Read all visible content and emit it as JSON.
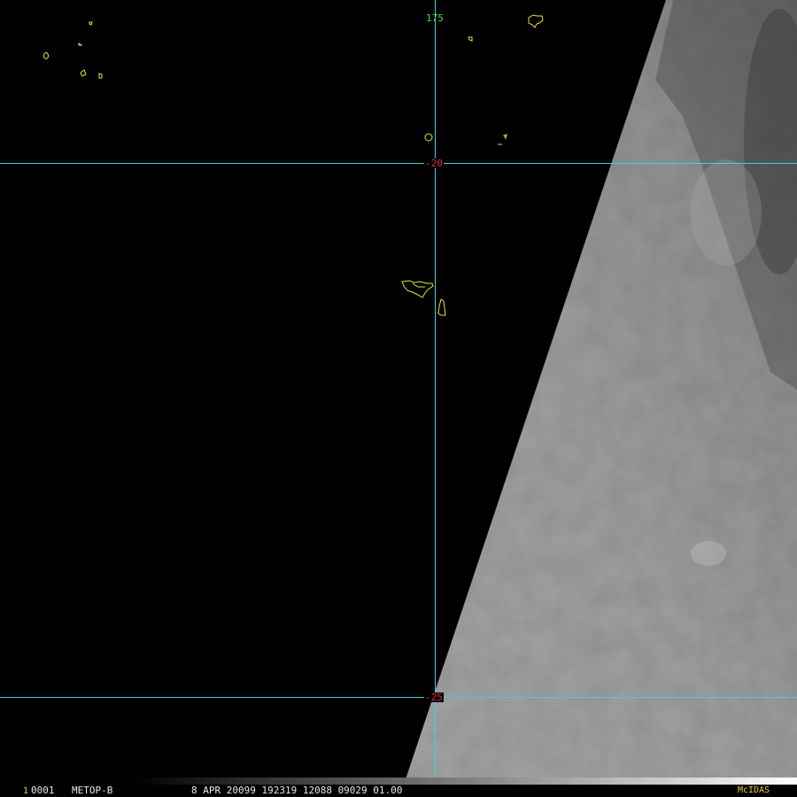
{
  "image": {
    "satellite": "METOP-B",
    "frame": "1",
    "frame_id": "0001",
    "info": "8 APR 20099 192319 12088 09029 01.00",
    "software": "McIDAS"
  },
  "grid": {
    "color": "#40d0e0",
    "coastline_color": "#e6e62e",
    "longitude_labels": [
      "175"
    ],
    "latitude_labels": [
      "-20",
      "-25"
    ]
  },
  "colors": {
    "background": "#000000",
    "lon_label": "#3ee03e",
    "lat_label": "#e03030"
  }
}
